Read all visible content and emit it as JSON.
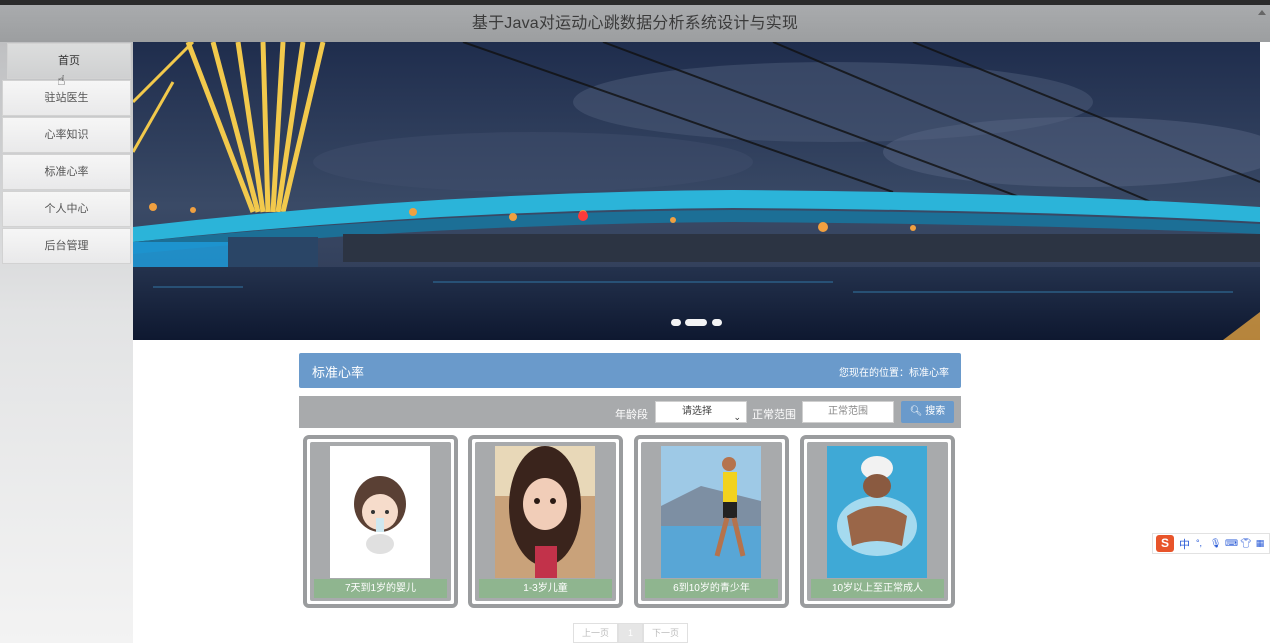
{
  "app": {
    "title": "基于Java对运动心跳数据分析系统设计与实现"
  },
  "sidebar": {
    "items": [
      {
        "label": "首页",
        "active": true
      },
      {
        "label": "驻站医生"
      },
      {
        "label": "心率知识"
      },
      {
        "label": "标准心率"
      },
      {
        "label": "个人中心"
      },
      {
        "label": "后台管理"
      }
    ]
  },
  "banner": {
    "slides": 3,
    "active_index": 1
  },
  "section": {
    "title": "标准心率",
    "breadcrumb": "您现在的位置：标准心率"
  },
  "search": {
    "age_label": "年龄段",
    "age_selected": "请选择",
    "range_label": "正常范围",
    "range_placeholder": "正常范围",
    "button_label": "搜索"
  },
  "cards": [
    {
      "caption": "7天到1岁的婴儿"
    },
    {
      "caption": "1-3岁儿童"
    },
    {
      "caption": "6到10岁的青少年"
    },
    {
      "caption": "10岁以上至正常成人"
    }
  ],
  "pagination": {
    "prev": "上一页",
    "current": "1",
    "next": "下一页"
  },
  "ime": {
    "mode": "中",
    "punct": "°,"
  },
  "colors": {
    "accent": "#6a9acb",
    "caption": "#8fb58f",
    "header": "#a8aaac"
  }
}
